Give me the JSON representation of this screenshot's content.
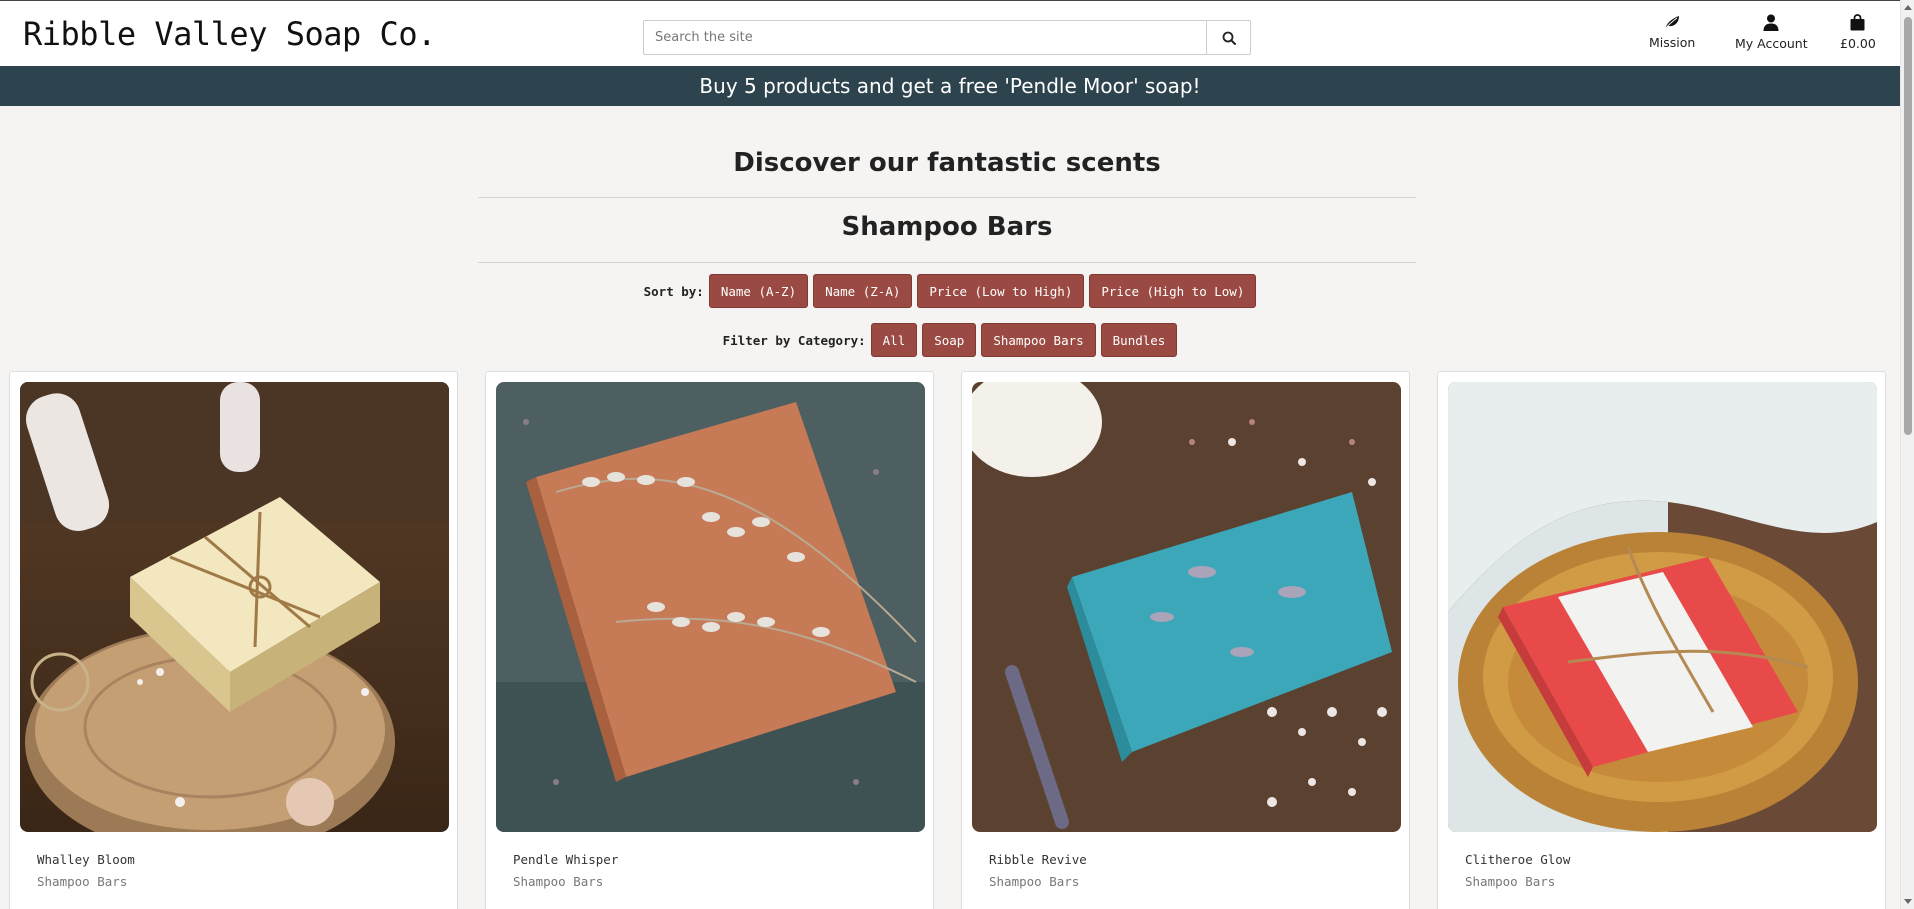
{
  "header": {
    "brand": "Ribble Valley Soap Co.",
    "search_placeholder": "Search the site",
    "nav": {
      "mission": "Mission",
      "account": "My Account",
      "basket_total": "£0.00"
    }
  },
  "banner": {
    "text": "Buy 5 products and get a free 'Pendle Moor' soap!"
  },
  "main": {
    "heading": "Discover our fantastic scents",
    "category_title": "Shampoo Bars",
    "sort": {
      "label": "Sort by:",
      "options": [
        "Name (A-Z)",
        "Name (Z-A)",
        "Price (Low to High)",
        "Price (High to Low)"
      ]
    },
    "filter": {
      "label": "Filter by Category:",
      "options": [
        "All",
        "Soap",
        "Shampoo Bars",
        "Bundles"
      ]
    },
    "products": [
      {
        "name": "Whalley Bloom",
        "category": "Shampoo Bars",
        "image": "cream-soap-on-wood-slice"
      },
      {
        "name": "Pendle Whisper",
        "category": "Shampoo Bars",
        "image": "orange-soap-with-lavender"
      },
      {
        "name": "Ribble Revive",
        "category": "Shampoo Bars",
        "image": "blue-soap-with-dried-flowers"
      },
      {
        "name": "Clitheroe Glow",
        "category": "Shampoo Bars",
        "image": "red-white-soap-in-wooden-bowl"
      }
    ]
  },
  "colors": {
    "banner_bg": "#2d434d",
    "button_bg": "#9a4a42",
    "page_bg": "#f5f4f2"
  }
}
